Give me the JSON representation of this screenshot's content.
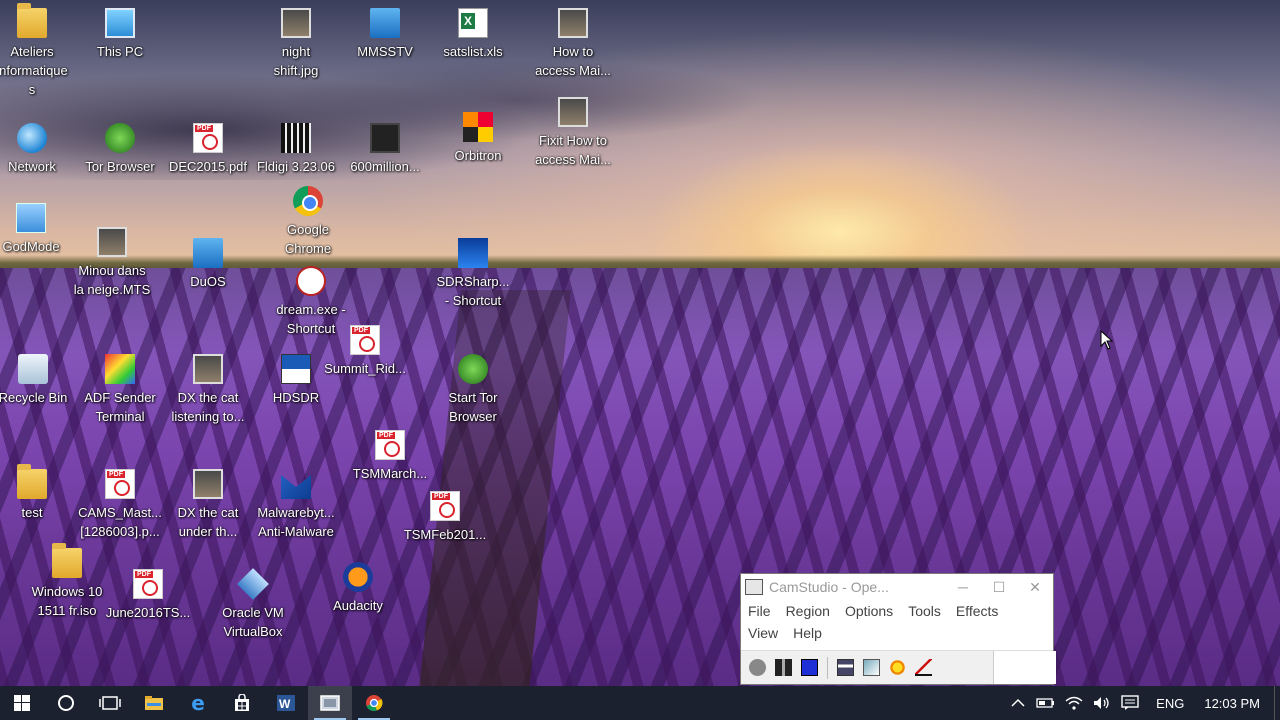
{
  "desktop_icons": [
    {
      "label": "Ateliers\ninformatique\ns",
      "icon": "folder-icon"
    },
    {
      "label": "This PC",
      "icon": "computer-icon"
    },
    {
      "label": "night\nshift.jpg",
      "icon": "image-file-icon"
    },
    {
      "label": "MMSSTV",
      "icon": "mmsstv-app-icon"
    },
    {
      "label": "satslist.xls",
      "icon": "excel-file-icon"
    },
    {
      "label": "How to\naccess Mai...",
      "icon": "video-file-icon"
    },
    {
      "label": "Network",
      "icon": "network-icon"
    },
    {
      "label": "Tor Browser",
      "icon": "tor-browser-icon"
    },
    {
      "label": "DEC2015.pdf",
      "icon": "pdf-file-icon"
    },
    {
      "label": "Fldigi 3.23.06",
      "icon": "fldigi-app-icon"
    },
    {
      "label": "600million...",
      "icon": "video-file-icon"
    },
    {
      "label": "Orbitron",
      "icon": "orbitron-app-icon"
    },
    {
      "label": "Fixit How to\naccess Mai...",
      "icon": "video-file-icon"
    },
    {
      "label": "Google\nChrome",
      "icon": "chrome-icon"
    },
    {
      "label": "GodMode",
      "icon": "godmode-folder-icon"
    },
    {
      "label": "Minou dans\nla neige.MTS",
      "icon": "video-file-icon"
    },
    {
      "label": "DuOS",
      "icon": "duos-app-icon"
    },
    {
      "label": "dream.exe -\nShortcut",
      "icon": "dream-app-icon"
    },
    {
      "label": "SDRSharp...\n- Shortcut",
      "icon": "sdrsharp-app-icon"
    },
    {
      "label": "Summit_Rid...",
      "icon": "pdf-file-icon"
    },
    {
      "label": "Recycle Bin",
      "icon": "recycle-bin-icon"
    },
    {
      "label": "ADF Sender\nTerminal",
      "icon": "adf-sender-icon"
    },
    {
      "label": "DX the cat\nlistening to...",
      "icon": "video-file-icon"
    },
    {
      "label": "HDSDR",
      "icon": "hdsdr-app-icon"
    },
    {
      "label": "Start Tor\nBrowser",
      "icon": "tor-browser-icon"
    },
    {
      "label": "TSMMarch...",
      "icon": "pdf-file-icon"
    },
    {
      "label": "test",
      "icon": "folder-icon"
    },
    {
      "label": "CAMS_Mast...\n[1286003].p...",
      "icon": "pdf-file-icon"
    },
    {
      "label": "DX the cat\nunder th...",
      "icon": "video-file-icon"
    },
    {
      "label": "Malwarebyt...\nAnti-Malware",
      "icon": "malwarebytes-icon"
    },
    {
      "label": "TSMFeb201...",
      "icon": "pdf-file-icon"
    },
    {
      "label": "Windows 10\n1511 fr.iso",
      "icon": "iso-file-icon"
    },
    {
      "label": "June2016TS...",
      "icon": "pdf-file-icon"
    },
    {
      "label": "Oracle VM\nVirtualBox",
      "icon": "virtualbox-icon"
    },
    {
      "label": "Audacity",
      "icon": "audacity-icon"
    }
  ],
  "camstudio": {
    "title": "CamStudio - Ope...",
    "minimize": "─",
    "maximize": "☐",
    "close": "✕",
    "menu": [
      "File",
      "Region",
      "Options",
      "Tools",
      "Effects",
      "View",
      "Help"
    ],
    "toolbar": [
      "record-icon",
      "pause-icon",
      "stop-icon",
      "region-icon",
      "annotate-icon",
      "effects-sun-icon",
      "autopan-icon"
    ]
  },
  "taskbar": {
    "apps": [
      "start-windows-icon",
      "cortana-search-icon",
      "task-view-icon",
      "file-explorer-icon",
      "edge-icon",
      "store-icon",
      "word-icon",
      "camstudio-icon",
      "chrome-icon"
    ],
    "tray": {
      "language": "ENG",
      "clock": "12:03 PM"
    }
  },
  "colors": {
    "taskbar_bg": "#1c2130",
    "stop_button": "#1f2fd8"
  }
}
